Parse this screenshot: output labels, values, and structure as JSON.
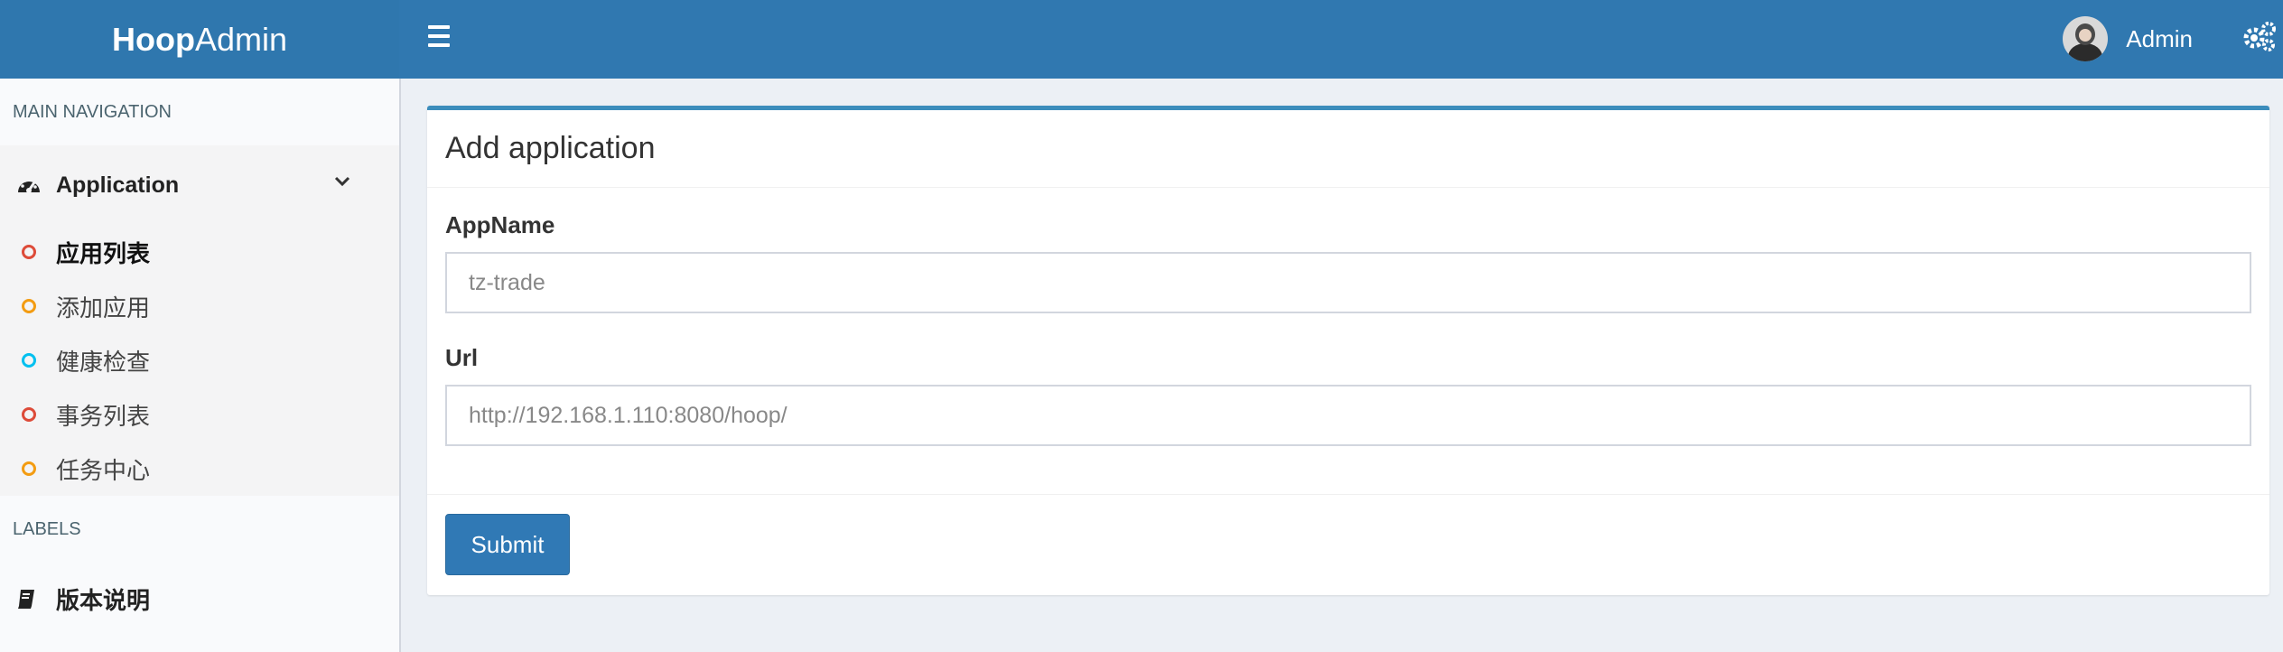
{
  "header": {
    "logo_bold": "Hoop",
    "logo_light": "Admin",
    "user_name": "Admin"
  },
  "sidebar": {
    "main_nav_header": "MAIN NAVIGATION",
    "application_label": "Application",
    "items": [
      {
        "label": "应用列表",
        "color": "#dd4b39",
        "active": true
      },
      {
        "label": "添加应用",
        "color": "#f39c12",
        "active": false
      },
      {
        "label": "健康检查",
        "color": "#00c0ef",
        "active": false
      },
      {
        "label": "事务列表",
        "color": "#dd4b39",
        "active": false
      },
      {
        "label": "任务中心",
        "color": "#f39c12",
        "active": false
      }
    ],
    "labels_header": "LABELS",
    "version_label": "版本说明"
  },
  "form": {
    "title": "Add application",
    "appname_label": "AppName",
    "appname_placeholder": "tz-trade",
    "url_label": "Url",
    "url_placeholder": "http://192.168.1.110:8080/hoop/",
    "submit_label": "Submit"
  },
  "colors": {
    "header_bg": "#3078b0",
    "accent": "#3c8dbc"
  }
}
